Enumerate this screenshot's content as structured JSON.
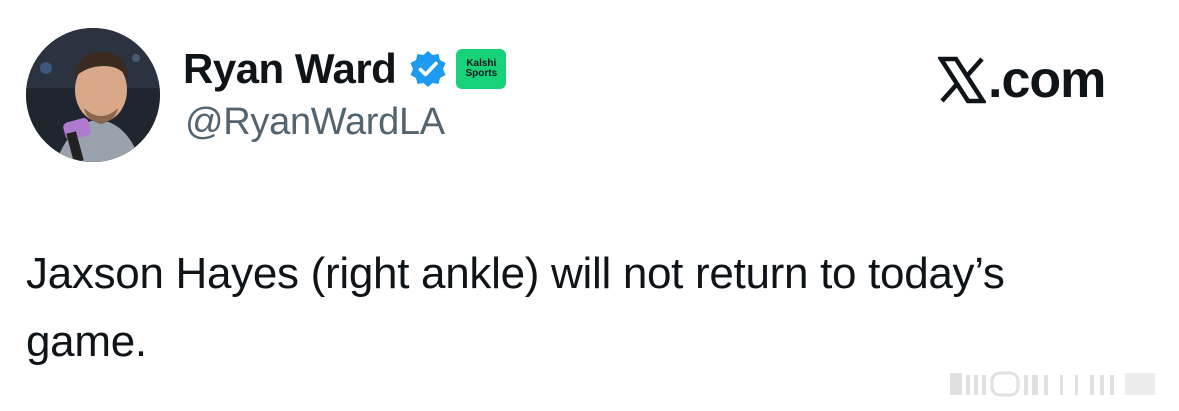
{
  "author": {
    "display_name": "Ryan Ward",
    "handle": "@RyanWardLA",
    "verified": true,
    "affiliate": {
      "name_line1": "Kalshi",
      "name_line2": "Sports",
      "color": "#18d27a"
    }
  },
  "site": {
    "suffix": ".com",
    "icon": "x-logo-icon"
  },
  "tweet": {
    "text": "Jaxson Hayes (right ankle) will not return to today’s game."
  },
  "colors": {
    "text": "#0f1419",
    "secondary_text": "#536471",
    "verified_blue": "#1d9bf0",
    "background": "#ffffff"
  }
}
